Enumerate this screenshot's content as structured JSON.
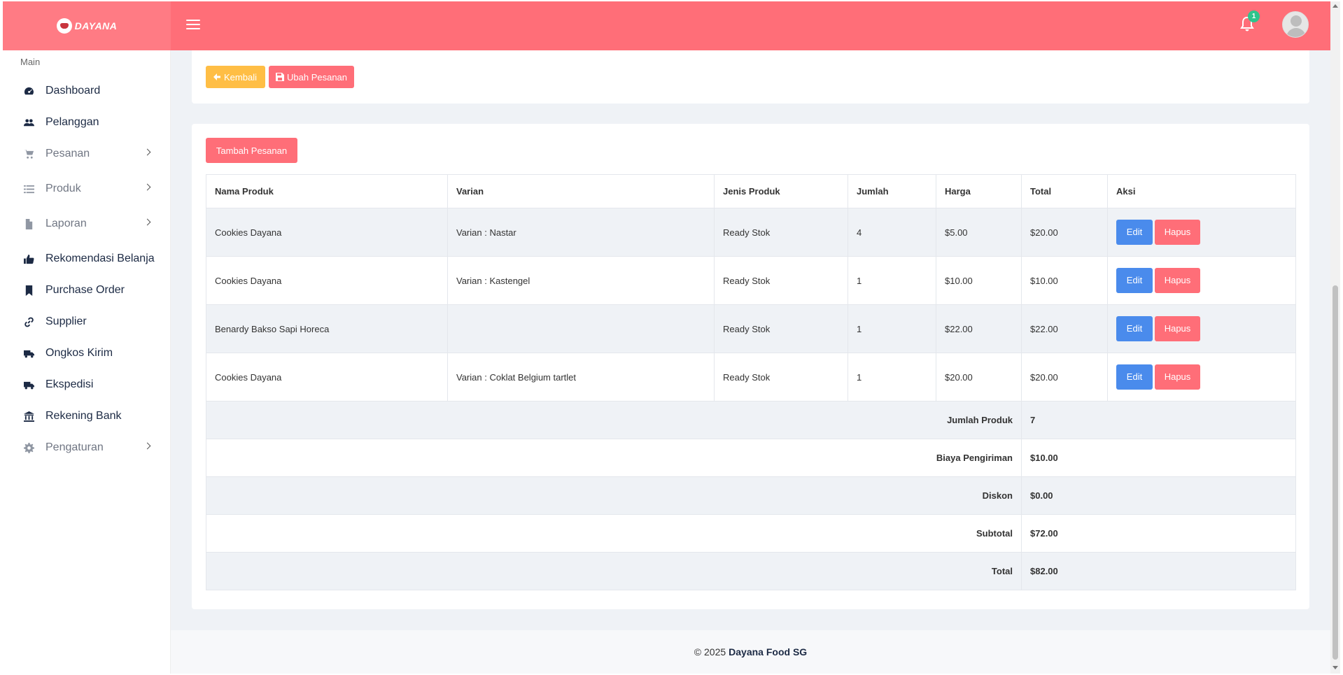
{
  "brand": {
    "name": "DAYANA"
  },
  "header": {
    "notification_count": "1"
  },
  "sidebar": {
    "caption": "Main",
    "items": [
      {
        "label": "Dashboard",
        "icon": "dashboard-icon"
      },
      {
        "label": "Pelanggan",
        "icon": "users-icon"
      },
      {
        "label": "Pesanan",
        "icon": "cart-icon"
      },
      {
        "label": "Produk",
        "icon": "list-icon"
      },
      {
        "label": "Laporan",
        "icon": "file-icon"
      },
      {
        "label": "Rekomendasi Belanja",
        "icon": "thumbs-up-icon"
      },
      {
        "label": "Purchase Order",
        "icon": "bookmark-icon"
      },
      {
        "label": "Supplier",
        "icon": "link-icon"
      },
      {
        "label": "Ongkos Kirim",
        "icon": "truck-icon"
      },
      {
        "label": "Ekspedisi",
        "icon": "truck-icon"
      },
      {
        "label": "Rekening Bank",
        "icon": "bank-icon"
      },
      {
        "label": "Pengaturan",
        "icon": "gear-icon"
      }
    ]
  },
  "actions": {
    "back_label": "Kembali",
    "save_label": "Ubah Pesanan",
    "add_label": "Tambah Pesanan"
  },
  "table": {
    "headers": [
      "Nama Produk",
      "Varian",
      "Jenis Produk",
      "Jumlah",
      "Harga",
      "Total",
      "Aksi"
    ],
    "rows": [
      {
        "name": "Cookies Dayana",
        "variant": "Varian : Nastar",
        "type": "Ready Stok",
        "qty": "4",
        "price": "$5.00",
        "total": "$20.00"
      },
      {
        "name": "Cookies Dayana",
        "variant": "Varian : Kastengel",
        "type": "Ready Stok",
        "qty": "1",
        "price": "$10.00",
        "total": "$10.00"
      },
      {
        "name": "Benardy Bakso Sapi Horeca",
        "variant": "",
        "type": "Ready Stok",
        "qty": "1",
        "price": "$22.00",
        "total": "$22.00"
      },
      {
        "name": "Cookies Dayana",
        "variant": "Varian : Coklat Belgium tartlet",
        "type": "Ready Stok",
        "qty": "1",
        "price": "$20.00",
        "total": "$20.00"
      }
    ],
    "edit_label": "Edit",
    "delete_label": "Hapus",
    "summary": [
      {
        "label": "Jumlah Produk",
        "value": "7"
      },
      {
        "label": "Biaya Pengiriman",
        "value": "$10.00"
      },
      {
        "label": "Diskon",
        "value": "$0.00"
      },
      {
        "label": "Subtotal",
        "value": "$72.00"
      },
      {
        "label": "Total",
        "value": "$82.00"
      }
    ]
  },
  "footer": {
    "copyright": "© 2025",
    "company": "Dayana Food SG"
  }
}
